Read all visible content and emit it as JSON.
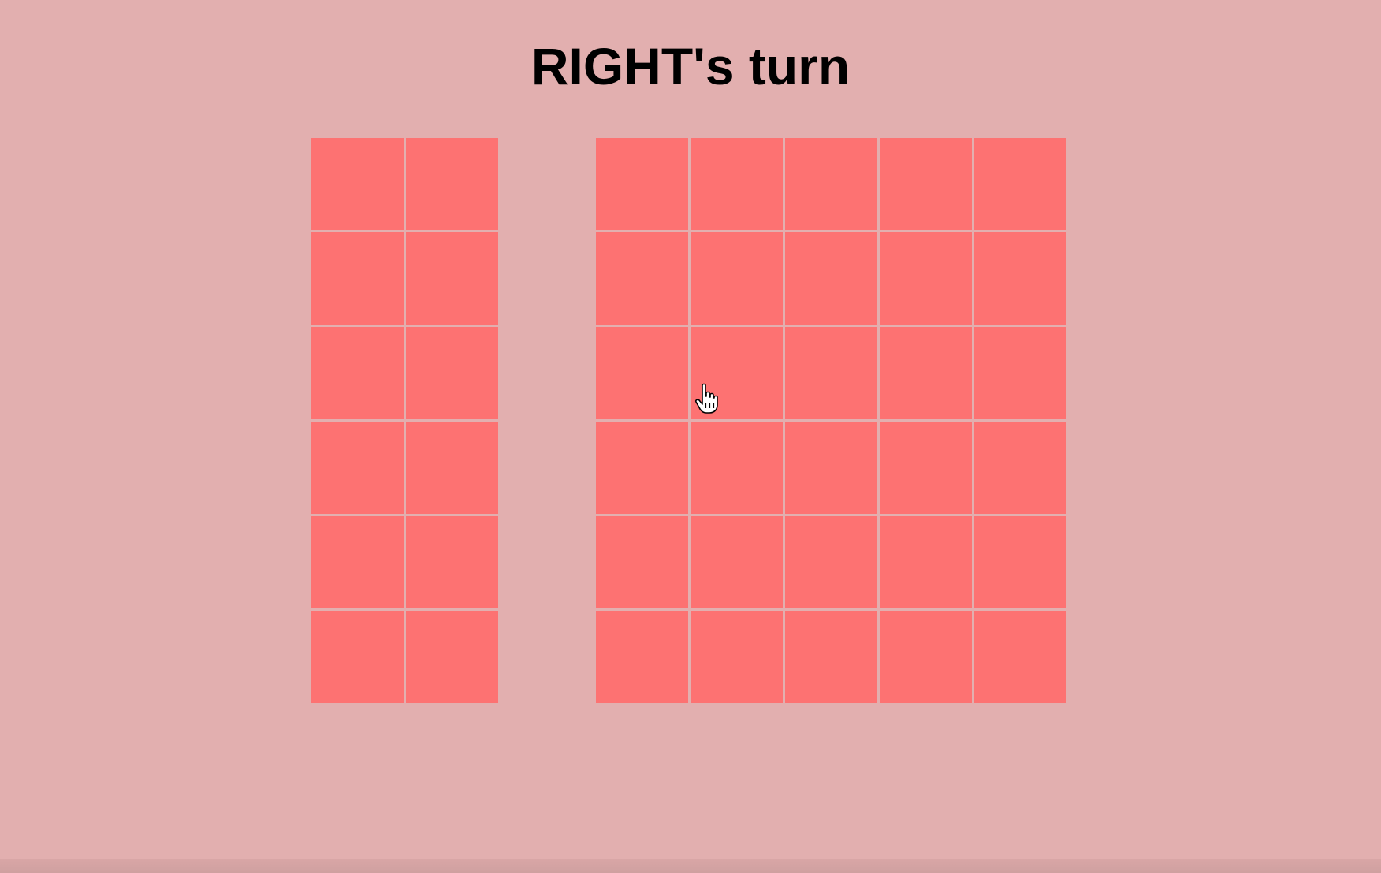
{
  "header": {
    "turn_text": "RIGHT's turn"
  },
  "boards": {
    "left": {
      "columns": 2,
      "rows": 6
    },
    "right": {
      "columns": 5,
      "rows": 6
    }
  },
  "colors": {
    "background": "#e2afaf",
    "cell": "#fd7272",
    "text": "#000000"
  },
  "cursor": {
    "icon": "hand-pointer-icon"
  }
}
